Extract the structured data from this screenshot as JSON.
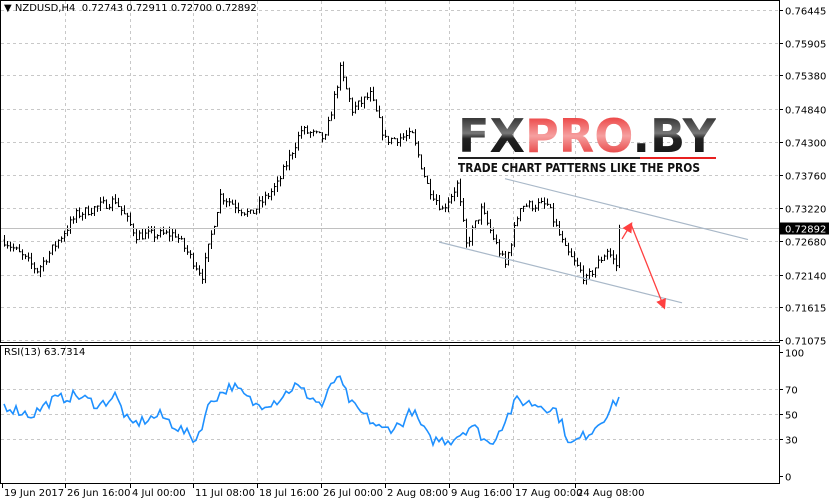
{
  "header": {
    "symbol": "NZDUSD,H4",
    "open": "0.72743",
    "high": "0.72911",
    "low": "0.72700",
    "close": "0.72892"
  },
  "logo": {
    "brand": "FXPRO.BY",
    "tagline": "TRADE CHART PATTERNS LIKE THE PROS"
  },
  "colors": {
    "rsi": "#1E90FF",
    "arrow": "#FF4040",
    "channel": "#A9B8C8",
    "bars": "#000000",
    "grid": "#C8C8C8"
  },
  "chart_data": [
    {
      "type": "candlestick",
      "title": "NZDUSD,H4",
      "y_ticks": [
        "0.76445",
        "0.75905",
        "0.75380",
        "0.74840",
        "0.74300",
        "0.73760",
        "0.73220",
        "0.72680",
        "0.72140",
        "0.71615",
        "0.71075"
      ],
      "ylim": [
        0.71075,
        0.76445
      ],
      "current_price": "0.72892",
      "x_ticks": [
        "19 Jun 2017",
        "26 Jun 16:00",
        "4 Jul 00:00",
        "11 Jul 08:00",
        "18 Jul 16:00",
        "26 Jul 00:00",
        "2 Aug 08:00",
        "9 Aug 16:00",
        "17 Aug 00:00",
        "24 Aug 08:00"
      ],
      "bar_count": 206,
      "close_keypoints": [
        [
          0,
          0.727
        ],
        [
          11,
          0.7221
        ],
        [
          24,
          0.7311
        ],
        [
          37,
          0.7335
        ],
        [
          44,
          0.7278
        ],
        [
          57,
          0.728
        ],
        [
          66,
          0.7213
        ],
        [
          72,
          0.7343
        ],
        [
          82,
          0.7311
        ],
        [
          91,
          0.736
        ],
        [
          99,
          0.7449
        ],
        [
          107,
          0.7435
        ],
        [
          112,
          0.7547
        ],
        [
          116,
          0.7482
        ],
        [
          122,
          0.7506
        ],
        [
          127,
          0.7433
        ],
        [
          136,
          0.744
        ],
        [
          141,
          0.736
        ],
        [
          146,
          0.732
        ],
        [
          151,
          0.736
        ],
        [
          154,
          0.7262
        ],
        [
          159,
          0.7319
        ],
        [
          167,
          0.7229
        ],
        [
          172,
          0.7327
        ],
        [
          181,
          0.7327
        ],
        [
          187,
          0.7254
        ],
        [
          194,
          0.7205
        ],
        [
          201,
          0.7254
        ],
        [
          204,
          0.7229
        ],
        [
          205,
          0.72892
        ]
      ],
      "channel": {
        "upper": [
          [
            167,
            0.737
          ],
          [
            248,
            0.7271
          ]
        ],
        "lower": [
          [
            145,
            0.7267
          ],
          [
            226,
            0.7168
          ]
        ]
      },
      "projection": [
        [
          206,
          0.7272
        ],
        [
          209,
          0.7296
        ],
        [
          220,
          0.7161
        ]
      ]
    },
    {
      "type": "line",
      "title": "RSI(13)",
      "current_value": "63.7314",
      "y_ticks": [
        "100",
        "70",
        "50",
        "30",
        "0"
      ],
      "ylim": [
        0,
        100
      ],
      "keypoints": [
        [
          0,
          57
        ],
        [
          9,
          49
        ],
        [
          16,
          61
        ],
        [
          24,
          65
        ],
        [
          32,
          57
        ],
        [
          37,
          65
        ],
        [
          42,
          41
        ],
        [
          52,
          49
        ],
        [
          64,
          29
        ],
        [
          69,
          61
        ],
        [
          76,
          73
        ],
        [
          84,
          57
        ],
        [
          91,
          61
        ],
        [
          97,
          73
        ],
        [
          106,
          57
        ],
        [
          111,
          81
        ],
        [
          116,
          57
        ],
        [
          126,
          37
        ],
        [
          132,
          41
        ],
        [
          136,
          53
        ],
        [
          142,
          29
        ],
        [
          149,
          29
        ],
        [
          156,
          41
        ],
        [
          162,
          25
        ],
        [
          171,
          61
        ],
        [
          179,
          57
        ],
        [
          184,
          53
        ],
        [
          189,
          25
        ],
        [
          196,
          37
        ],
        [
          202,
          53
        ],
        [
          205,
          63.7
        ]
      ]
    }
  ]
}
